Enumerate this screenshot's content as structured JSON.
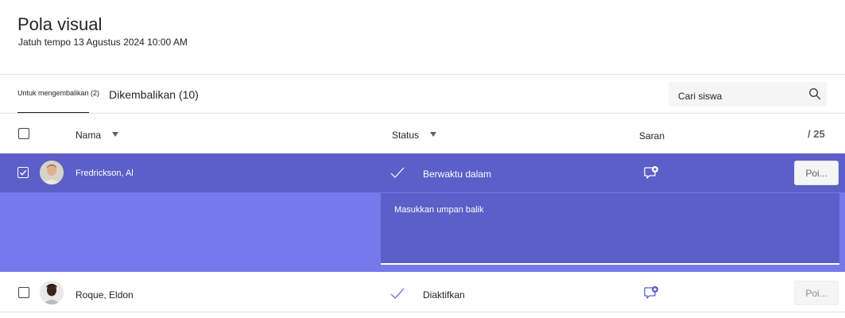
{
  "header": {
    "title": "Pola visual",
    "due": "Jatuh tempo 13 Agustus 2024 10:00 AM"
  },
  "tabs": [
    {
      "label": "Untuk mengembalikan (2)",
      "active": true
    },
    {
      "label": "Dikembalikan (10)",
      "active": false
    }
  ],
  "search": {
    "placeholder": "Cari siswa",
    "icon": "search-icon"
  },
  "columns": {
    "name": "Nama",
    "status": "Status",
    "feedback": "Saran",
    "points": "/ 25"
  },
  "students": [
    {
      "name": "Fredrickson, Al",
      "status": "Berwaktu dalam",
      "selected": true,
      "points_label": "Poi...",
      "feedback_placeholder": "Masukkan umpan balik"
    },
    {
      "name": "Roque, Eldon",
      "status": "Diaktifkan",
      "selected": false,
      "points_label": "Poi..."
    }
  ],
  "colors": {
    "accent": "#5b5fc7",
    "accent_light": "#7579eb",
    "icon_purple": "#5b5fc7"
  }
}
